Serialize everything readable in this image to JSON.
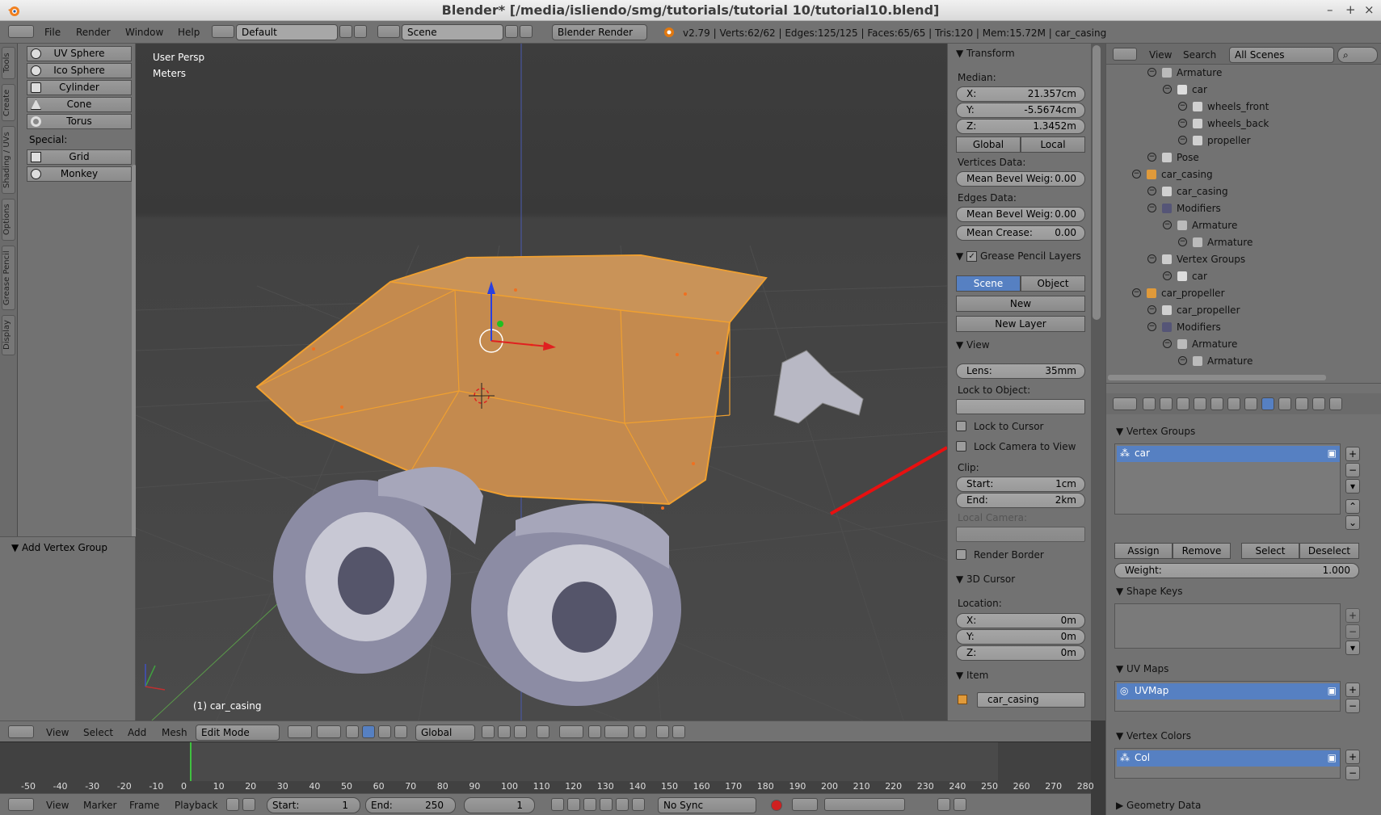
{
  "window": {
    "title": "Blender* [/media/isliendo/smg/tutorials/tutorial 10/tutorial10.blend]",
    "controls": [
      "–",
      "+",
      "×"
    ]
  },
  "info_header": {
    "menus": [
      "File",
      "Render",
      "Window",
      "Help"
    ],
    "layout": "Default",
    "scene": "Scene",
    "render_engine": "Blender Render",
    "stats": "v2.79 | Verts:62/62 | Edges:125/125 | Faces:65/65 | Tris:120 | Mem:15.72M | car_casing"
  },
  "tool_shelf": {
    "tabs": [
      "Tools",
      "Create",
      "Shading / UVs",
      "Options",
      "Grease Pencil",
      "Display"
    ],
    "buttons": [
      "UV Sphere",
      "Ico Sphere",
      "Cylinder",
      "Cone",
      "Torus"
    ],
    "special_label": "Special:",
    "special_buttons": [
      "Grid",
      "Monkey"
    ],
    "operator_panel": "Add Vertex Group"
  },
  "viewport": {
    "view_name": "User Persp",
    "units": "Meters",
    "object_label": "(1) car_casing",
    "colors": {
      "selection": "#f0a030",
      "mesh": "#9a9aaa"
    }
  },
  "properties_panel": {
    "transform_header": "Transform",
    "median_label": "Median:",
    "x_label": "X:",
    "x_value": "21.357cm",
    "y_label": "Y:",
    "y_value": "-5.5674cm",
    "z_label": "Z:",
    "z_value": "1.3452m",
    "global": "Global",
    "local": "Local",
    "vertices_data": "Vertices Data:",
    "mean_bevel_weight_label": "Mean Bevel Weig:",
    "mean_bevel_weight_v": "0.00",
    "edges_data": "Edges Data:",
    "mean_bevel_weight_e": "0.00",
    "mean_crease_label": "Mean Crease:",
    "mean_crease": "0.00",
    "grease_pencil_header": "Grease Pencil Layers",
    "gp_scene": "Scene",
    "gp_object": "Object",
    "gp_new": "New",
    "gp_new_layer": "New Layer",
    "view_header": "View",
    "lens_label": "Lens:",
    "lens_value": "35mm",
    "lock_to_object": "Lock to Object:",
    "lock_to_cursor": "Lock to Cursor",
    "lock_camera_to_view": "Lock Camera to View",
    "clip_label": "Clip:",
    "clip_start_label": "Start:",
    "clip_start": "1cm",
    "clip_end_label": "End:",
    "clip_end": "2km",
    "local_camera": "Local Camera:",
    "render_border": "Render Border",
    "cursor_header": "3D Cursor",
    "location_label": "Location:",
    "cursor_x": "0m",
    "cursor_y": "0m",
    "cursor_z": "0m",
    "item_header": "Item",
    "item_name": "car_casing"
  },
  "outliner": {
    "view": "View",
    "search": "Search",
    "filter": "All Scenes",
    "rows": [
      {
        "label": "Armature",
        "indent": 0
      },
      {
        "label": "car",
        "indent": 1
      },
      {
        "label": "wheels_front",
        "indent": 2
      },
      {
        "label": "wheels_back",
        "indent": 2
      },
      {
        "label": "propeller",
        "indent": 2
      },
      {
        "label": "Pose",
        "indent": 0
      },
      {
        "label": "car_casing",
        "indent": -1
      },
      {
        "label": "car_casing",
        "indent": 0
      },
      {
        "label": "Modifiers",
        "indent": 0
      },
      {
        "label": "Armature",
        "indent": 1
      },
      {
        "label": "Armature",
        "indent": 2
      },
      {
        "label": "Vertex Groups",
        "indent": 0
      },
      {
        "label": "car",
        "indent": 1
      },
      {
        "label": "car_propeller",
        "indent": -1
      },
      {
        "label": "car_propeller",
        "indent": 0
      },
      {
        "label": "Modifiers",
        "indent": 0
      },
      {
        "label": "Armature",
        "indent": 1
      },
      {
        "label": "Armature",
        "indent": 2
      }
    ]
  },
  "data_properties": {
    "vertex_groups_header": "Vertex Groups",
    "vertex_group_selected": "car",
    "assign": "Assign",
    "remove": "Remove",
    "select": "Select",
    "deselect": "Deselect",
    "weight_label": "Weight:",
    "weight_value": "1.000",
    "shape_keys_header": "Shape Keys",
    "uv_maps_header": "UV Maps",
    "uv_map": "UVMap",
    "vertex_colors_header": "Vertex Colors",
    "vertex_color": "Col",
    "geometry_data_header": "Geometry Data"
  },
  "view3d_header": {
    "menus": [
      "View",
      "Select",
      "Add",
      "Mesh"
    ],
    "mode": "Edit Mode",
    "orientation": "Global"
  },
  "timeline": {
    "ticks": [
      "-50",
      "-40",
      "-30",
      "-20",
      "-10",
      "0",
      "10",
      "20",
      "30",
      "40",
      "50",
      "60",
      "70",
      "80",
      "90",
      "100",
      "110",
      "120",
      "130",
      "140",
      "150",
      "160",
      "170",
      "180",
      "190",
      "200",
      "210",
      "220",
      "230",
      "240",
      "250",
      "260",
      "270",
      "280"
    ],
    "menus": [
      "View",
      "Marker",
      "Frame",
      "Playback"
    ],
    "start_label": "Start:",
    "start": "1",
    "end_label": "End:",
    "end": "250",
    "current": "1",
    "sync": "No Sync"
  }
}
